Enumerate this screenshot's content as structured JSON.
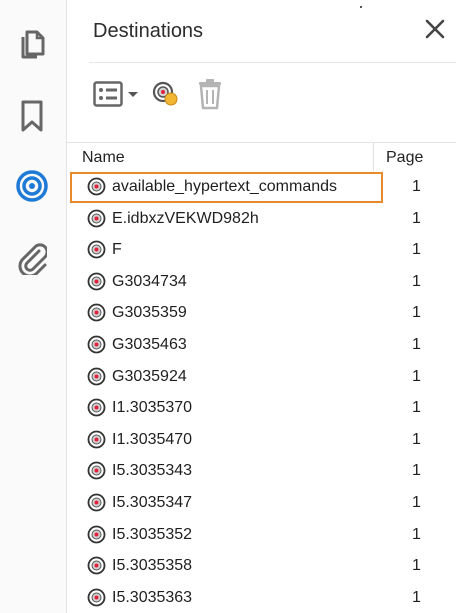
{
  "rail": {
    "items": [
      {
        "icon": "pages-icon"
      },
      {
        "icon": "bookmark-icon"
      },
      {
        "icon": "destinations-icon",
        "active": true
      },
      {
        "icon": "attachment-icon"
      }
    ]
  },
  "panel": {
    "title": "Destinations"
  },
  "table": {
    "headers": {
      "name": "Name",
      "page": "Page"
    },
    "rows": [
      {
        "name": "available_hypertext_commands",
        "page": "1",
        "selected": true
      },
      {
        "name": "E.idbxzVEKWD982h",
        "page": "1"
      },
      {
        "name": "F",
        "page": "1"
      },
      {
        "name": "G3034734",
        "page": "1"
      },
      {
        "name": "G3035359",
        "page": "1"
      },
      {
        "name": "G3035463",
        "page": "1"
      },
      {
        "name": "G3035924",
        "page": "1"
      },
      {
        "name": "I1.3035370",
        "page": "1"
      },
      {
        "name": "I1.3035470",
        "page": "1"
      },
      {
        "name": "I5.3035343",
        "page": "1"
      },
      {
        "name": "I5.3035347",
        "page": "1"
      },
      {
        "name": "I5.3035352",
        "page": "1"
      },
      {
        "name": "I5.3035358",
        "page": "1"
      },
      {
        "name": "I5.3035363",
        "page": "1"
      }
    ]
  },
  "colors": {
    "accent_blue": "#1f7ad6",
    "selection_orange": "#e8892b",
    "icon_gray": "#6b6b6b"
  }
}
